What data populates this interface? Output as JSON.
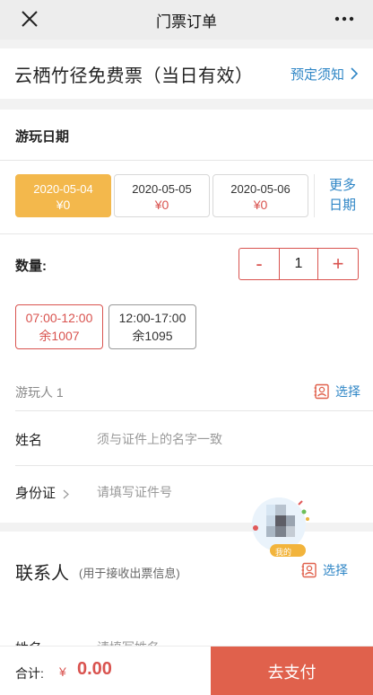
{
  "navbar": {
    "title": "门票订单",
    "close_icon": "close-icon",
    "more_icon": "more-icon"
  },
  "ticket": {
    "title": "云栖竹径免费票（当日有效）",
    "notice_link": "预定须知"
  },
  "date_section": {
    "label": "游玩日期",
    "dates": [
      {
        "date": "2020-05-04",
        "price": "¥0",
        "selected": true
      },
      {
        "date": "2020-05-05",
        "price": "¥0",
        "selected": false
      },
      {
        "date": "2020-05-06",
        "price": "¥0",
        "selected": false
      }
    ],
    "more_line1": "更多",
    "more_line2": "日期"
  },
  "quantity": {
    "label": "数量:",
    "minus": "-",
    "value": "1",
    "plus": "+"
  },
  "time_slots": [
    {
      "time": "07:00-12:00",
      "remaining": "余1007",
      "selected": true
    },
    {
      "time": "12:00-17:00",
      "remaining": "余1095",
      "selected": false
    }
  ],
  "visitor": {
    "label": "游玩人 1",
    "select": "选择",
    "name_label": "姓名",
    "name_placeholder": "须与证件上的名字一致",
    "id_label": "身份证",
    "id_placeholder": "请填写证件号"
  },
  "contact": {
    "title": "联系人",
    "subtitle": "(用于接收出票信息)",
    "select": "选择",
    "name_label": "姓名",
    "name_placeholder": "请填写姓名"
  },
  "float_widget": {
    "badge": "我的"
  },
  "bottom_bar": {
    "total_label": "合计:",
    "currency": "¥",
    "amount": "0.00",
    "pay_label": "去支付"
  },
  "colors": {
    "accent_red": "#d9534f",
    "link_blue": "#2f86c6",
    "selected_date": "#f3b84c",
    "pay_button": "#e0614c"
  }
}
